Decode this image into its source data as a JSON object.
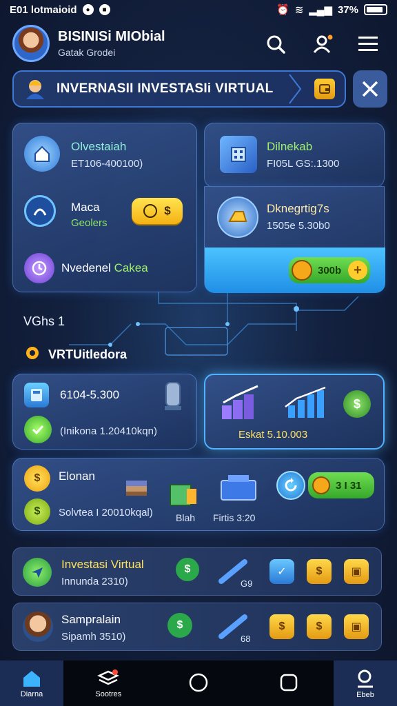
{
  "status_bar": {
    "time": "E01 lotmaioid",
    "battery": "37%"
  },
  "header": {
    "title": "BISINISi MIObial",
    "subtitle": "Gatak Grodei"
  },
  "banner": {
    "text": "INVERNASII INVESTASIi VIRTUAL"
  },
  "panel_left": {
    "items": [
      {
        "title": "Olvestaiah",
        "value": "ET106-400100)"
      },
      {
        "title": "Maca",
        "value": "Geolers"
      },
      {
        "title_white": "Nvedenel",
        "title_green": "Cakea"
      }
    ],
    "coin_button_symbol": "$"
  },
  "panel_right_top": {
    "title": "Dilnekab",
    "value": "FI05L GS:.1300"
  },
  "panel_right_mid": {
    "title": "Dknegrtig7s",
    "value": "1505e 5.30b0"
  },
  "panel_right_button": {
    "label": "300b"
  },
  "section": {
    "label": "VGhs 1",
    "title": "VRTUitledora"
  },
  "card_a": {
    "value": "6104-5.300",
    "caption": "(Inikona 1.20410kqn)"
  },
  "card_b": {
    "caption": "Eskat 5.10.003"
  },
  "earn": {
    "title": "Elonan",
    "caption": "Solvtea I 20010kqal)",
    "item1_label": "Blah",
    "item2_label": "Firtis 3:20",
    "button_label": "3 I 31"
  },
  "list": [
    {
      "title": "Investasi Virtual",
      "sub": "Innunda 2310)",
      "count": "G9"
    },
    {
      "title": "Sampralain",
      "sub": "Sipamh 3510)",
      "count": "68"
    }
  ],
  "nav": [
    {
      "label": "Diarna"
    },
    {
      "label": "Sootres"
    },
    {
      "label": ""
    },
    {
      "label": ""
    },
    {
      "label": "Ebeb"
    }
  ],
  "colors": {
    "accent": "#4fb3ff",
    "gold": "#f4b214",
    "green": "#36a82a",
    "bg": "#13213f"
  }
}
